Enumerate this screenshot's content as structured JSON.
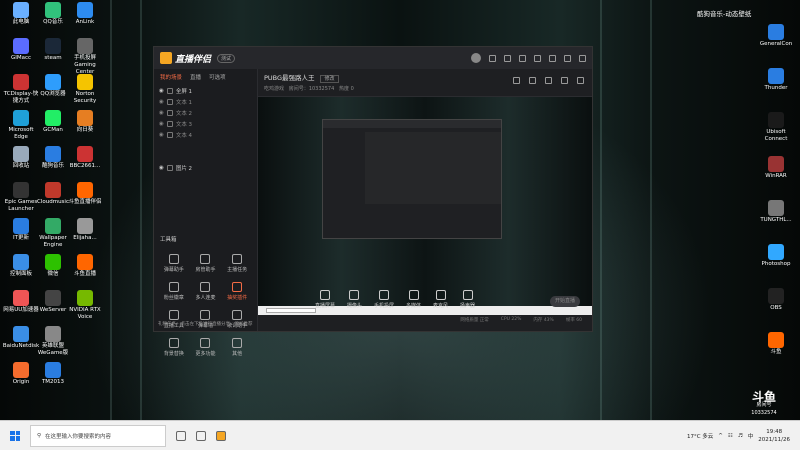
{
  "desktop": {
    "left_icons": [
      {
        "label": "此电脑",
        "color": "#6ab0ff"
      },
      {
        "label": "GIMacc",
        "color": "#5b6cff"
      },
      {
        "label": "TCDisplay-快捷方式",
        "color": "#c33"
      },
      {
        "label": "Microsoft Edge",
        "color": "#1fa0d8"
      },
      {
        "label": "回收站",
        "color": "#9ab"
      },
      {
        "label": "Epic Games Launcher",
        "color": "#333"
      },
      {
        "label": "IT更新",
        "color": "#2a7de1"
      },
      {
        "label": "控制面板",
        "color": "#3a8ee6"
      },
      {
        "label": "网易UU加速器",
        "color": "#e55"
      },
      {
        "label": "BaiduNetdisk",
        "color": "#3a8ee6"
      },
      {
        "label": "Origin",
        "color": "#f56c2d"
      },
      {
        "label": "QQ音乐",
        "color": "#31c27c"
      },
      {
        "label": "steam",
        "color": "#1b2838"
      },
      {
        "label": "QQ浏览器",
        "color": "#2e9dfc"
      },
      {
        "label": "GCMan",
        "color": "#2e6"
      },
      {
        "label": "酷狗音乐",
        "color": "#2a7de1"
      },
      {
        "label": "Cloudmusic",
        "color": "#c0392b"
      },
      {
        "label": "Wallpaper Engine",
        "color": "#3a6"
      },
      {
        "label": "微信",
        "color": "#2dc100"
      },
      {
        "label": "WeServer",
        "color": "#444"
      },
      {
        "label": "英雄联盟WeGame版",
        "color": "#888"
      },
      {
        "label": "TM2013",
        "color": "#2a7de1"
      },
      {
        "label": "AnLink",
        "color": "#2d8cf0"
      },
      {
        "label": "手机投屏Gaming Center",
        "color": "#666"
      },
      {
        "label": "Norton Security",
        "color": "#f5c400"
      },
      {
        "label": "向日葵",
        "color": "#e67e22"
      },
      {
        "label": "BBC2661...",
        "color": "#c33"
      },
      {
        "label": "斗鱼直播伴侣",
        "color": "#f60"
      },
      {
        "label": "Elijaha...",
        "color": "#999"
      },
      {
        "label": "斗鱼直播",
        "color": "#f60"
      },
      {
        "label": "NVIDIA RTX Voice",
        "color": "#76b900"
      }
    ],
    "right_icons": [
      {
        "label": "GeneralCon",
        "color": "#2a7de1"
      },
      {
        "label": "Thunder",
        "color": "#2a7de1"
      },
      {
        "label": "Ubisoft Connect",
        "color": "#1a1a1a"
      },
      {
        "label": "WinRAR",
        "color": "#933"
      },
      {
        "label": "TUNGTHL...",
        "color": "#777"
      },
      {
        "label": "Photoshop",
        "color": "#31a8ff"
      },
      {
        "label": "OBS",
        "color": "#222"
      },
      {
        "label": "斗鱼",
        "color": "#f60"
      }
    ],
    "music_widget": "酷狗音乐-动态壁纸",
    "banner": {
      "title": "斗鱼",
      "sub": "房间号",
      "num": "10332574"
    }
  },
  "app": {
    "logo": "直播伴侣",
    "version_badge": "测试",
    "left_tabs": [
      "我的场景",
      "直播",
      "可选项"
    ],
    "scenes": [
      {
        "label": "全屏 1",
        "active": true
      },
      {
        "label": "文本 1",
        "active": false
      },
      {
        "label": "文本 2",
        "active": false
      },
      {
        "label": "文本 3",
        "active": false
      },
      {
        "label": "文本 4",
        "active": false
      },
      {
        "label": "图片 2",
        "active": true
      }
    ],
    "tools_title": "工具箱",
    "tools": [
      {
        "label": "弹幕助手",
        "hl": false
      },
      {
        "label": "房管助手",
        "hl": false
      },
      {
        "label": "主播任务",
        "hl": false
      },
      {
        "label": "粉丝徽章",
        "hl": false
      },
      {
        "label": "多人连麦",
        "hl": false
      },
      {
        "label": "抽奖插件",
        "hl": true
      },
      {
        "label": "直播工具",
        "hl": false
      },
      {
        "label": "弹幕墙",
        "hl": false
      },
      {
        "label": "歌词助手",
        "hl": false
      },
      {
        "label": "背景替换",
        "hl": false
      },
      {
        "label": "更多功能",
        "hl": false
      },
      {
        "label": "其他",
        "hl": false
      }
    ],
    "notice": "礼物任务：点击左下角进行直播分享，添加推荐",
    "room": {
      "title": "PUBG最强路人王",
      "tag": "修改",
      "category": "吃鸡游戏",
      "room_label": "房间号：",
      "room_id": "10332574",
      "hot": "热度 0"
    },
    "controls": [
      "直播屏幕",
      "摄像头",
      "手机投屏",
      "多媒体",
      "麦克风",
      "扬声器"
    ],
    "live_button": "开始直播",
    "status": [
      "网络质量 正常",
      "CPU 22%",
      "内存 43%",
      "帧率 60"
    ]
  },
  "taskbar": {
    "search_placeholder": "在这里输入你要搜索的内容",
    "weather": "17°C 多云",
    "time": "19:48",
    "date": "2021/11/26"
  }
}
